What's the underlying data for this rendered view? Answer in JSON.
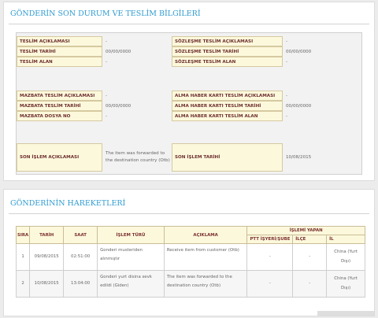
{
  "status": {
    "title": "GÖNDERİN SON DURUM VE TESLİM BİLGİLERİ",
    "group1": [
      {
        "l1": "TESLİM AÇIKLAMASI",
        "v1": "-",
        "l2": "SÖZLEŞME TESLİM AÇIKLAMASI",
        "v2": "-"
      },
      {
        "l1": "TESLİM TARİHİ",
        "v1": "00/00/0000",
        "l2": "SÖZLEŞME TESLİM TARİHİ",
        "v2": "00/00/0000"
      },
      {
        "l1": "TESLİM ALAN",
        "v1": "-",
        "l2": "SÖZLEŞME TESLİM ALAN",
        "v2": "-"
      }
    ],
    "group2": [
      {
        "l1": "MAZBATA TESLİM AÇIKLAMASI",
        "v1": "-",
        "l2": "ALMA HABER KARTI TESLİM AÇIKLAMASI",
        "v2": "-"
      },
      {
        "l1": "MAZBATA TESLİM TARİHİ",
        "v1": "00/00/0000",
        "l2": "ALMA HABER KARTI TESLİM TARİHİ",
        "v2": "00/00/0000"
      },
      {
        "l1": "MAZBATA DOSYA NO",
        "v1": "-",
        "l2": "ALMA HABER KARTI TESLİM ALAN",
        "v2": "-"
      }
    ],
    "last": {
      "l1": "SON İŞLEM AÇIKLAMASI",
      "v1": "The item was forwarded to the destination country (Otb)",
      "l2": "SON İŞLEM TARİHİ",
      "v2": "10/08/2015"
    }
  },
  "movements": {
    "title": "GÖNDERİNİN HAREKETLERİ",
    "headers": {
      "sira": "SIRA",
      "tarih": "TARİH",
      "saat": "SAAT",
      "islem_turu": "İŞLEM TÜRÜ",
      "aciklama": "AÇIKLAMA",
      "islemi_yapan": "İŞLEMİ YAPAN",
      "ptt": "PTT İŞYERİ/ŞUBE",
      "ilce": "İLÇE",
      "il": "İL"
    },
    "rows": [
      {
        "sira": "1",
        "tarih": "09/08/2015",
        "saat": "02:51:00",
        "islem_turu": "Gonderi musteriden alınmıştır",
        "aciklama": "Receive item from customer (Otb)",
        "ptt": "-",
        "ilce": "-",
        "il": "China (Yurt Dışı)"
      },
      {
        "sira": "2",
        "tarih": "10/08/2015",
        "saat": "13:04:00",
        "islem_turu": "Gonderi yurt disina sevk edildi (Giden)",
        "aciklama": "The item was forwarded to the destination country (Otb)",
        "ptt": "-",
        "ilce": "-",
        "il": "China (Yurt Dışı)"
      }
    ]
  }
}
